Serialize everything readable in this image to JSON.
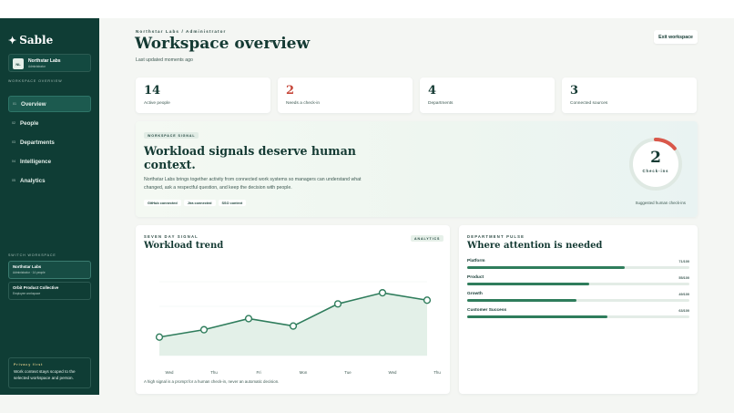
{
  "app": {
    "logo_text": "Sable"
  },
  "sidebar": {
    "workspace": {
      "initials": "NL",
      "name": "Northstar Labs",
      "role": "Administrator"
    },
    "section_label": "Workspace overview",
    "nav": [
      {
        "num": "01",
        "label": "Overview",
        "active": true
      },
      {
        "num": "02",
        "label": "People"
      },
      {
        "num": "03",
        "label": "Departments"
      },
      {
        "num": "04",
        "label": "Intelligence"
      },
      {
        "num": "05",
        "label": "Analytics"
      }
    ],
    "switch_label": "Switch workspace",
    "workspaces": [
      {
        "name": "Northstar Labs",
        "detail": "Administrator · 14 people",
        "active": true
      },
      {
        "name": "Orbit Product Collective",
        "detail": "Employee workspace"
      }
    ],
    "privacy": {
      "title": "Privacy first",
      "body": "Work context stays scoped to the selected workspace and person."
    }
  },
  "header": {
    "breadcrumb": "Northstar Labs / Administrator",
    "title": "Workspace overview",
    "updated": "Last updated moments ago",
    "exit_label": "Exit workspace"
  },
  "stats": [
    {
      "value": "14",
      "label": "Active people"
    },
    {
      "value": "2",
      "label": "Needs a check-in",
      "alert": true
    },
    {
      "value": "4",
      "label": "Departments"
    },
    {
      "value": "3",
      "label": "Connected sources"
    }
  ],
  "signal": {
    "pill": "Workspace signal",
    "headline": "Workload signals deserve human context.",
    "body": "Northstar Labs brings together activity from connected work systems so managers can understand what changed, ask a respectful question, and keep the decision with people.",
    "tags": [
      "GitHub connected",
      "Jira connected",
      "SSO context"
    ],
    "ring_value": "2",
    "ring_label": "Check-ins",
    "ring_fraction": 0.14,
    "suggest": "Suggested human check-ins",
    "colors": {
      "ring_track": "#dfe9e3",
      "ring_fill": "#d9574a"
    }
  },
  "trend": {
    "kicker": "Seven day signal",
    "title": "Workload trend",
    "badge": "Analytics",
    "footnote": "A high signal is a prompt for a human check-in, never an automatic decision."
  },
  "chart_data": {
    "type": "line",
    "x": [
      "Wed",
      "Thu",
      "Fri",
      "Mon",
      "Tue",
      "Wed",
      "Thu"
    ],
    "series": [
      {
        "values": [
          52,
          56,
          62,
          58,
          70,
          76,
          72
        ]
      }
    ],
    "ylim": [
      0,
      100
    ],
    "grid": true,
    "colors": {
      "line": "#2f7d5c",
      "area": "#e3f0e8"
    }
  },
  "pulse": {
    "kicker": "Department pulse",
    "title": "Where attention is needed",
    "departments": [
      {
        "name": "Platform",
        "score": "71/100",
        "value": 71
      },
      {
        "name": "Product",
        "score": "55/100",
        "value": 55
      },
      {
        "name": "Growth",
        "score": "49/100",
        "value": 49
      },
      {
        "name": "Customer Success",
        "score": "63/100",
        "value": 63
      }
    ]
  }
}
